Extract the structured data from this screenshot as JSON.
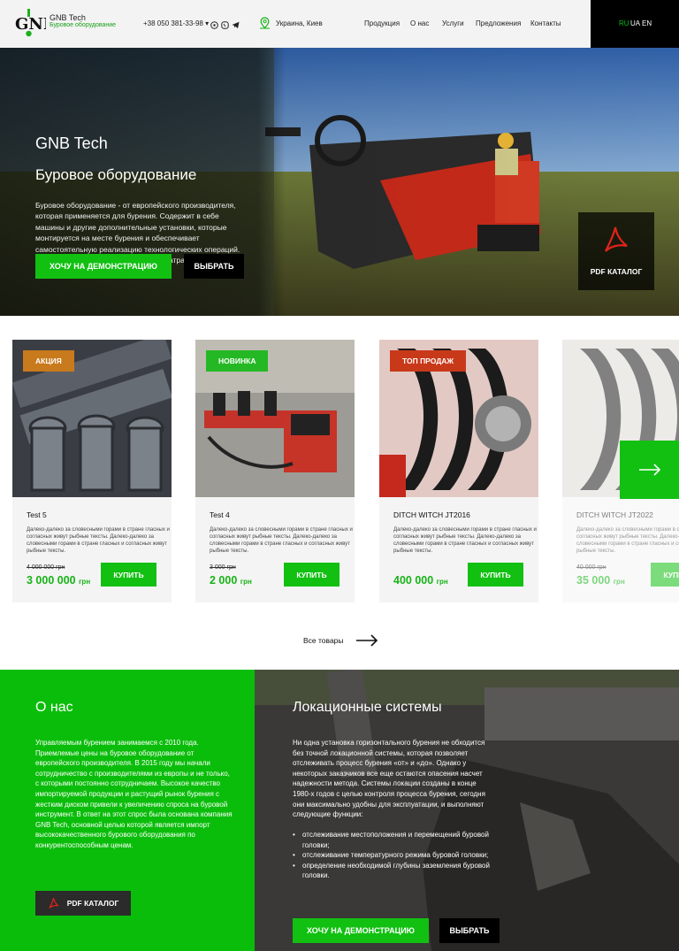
{
  "header": {
    "brand_name": "GNB Tech",
    "brand_sub": "Буровое оборудование",
    "phone": "+38 050 381-33-98",
    "location": "Украина, Киев",
    "nav": [
      "Продукция",
      "О нас",
      "Услуги",
      "Предложения",
      "Контакты"
    ],
    "langs": [
      "RU",
      "UA",
      "EN"
    ],
    "active_lang": "RU"
  },
  "hero": {
    "title": "GNB Tech",
    "subtitle": "Буровое оборудование",
    "text": "Буровое оборудование - от европейского производителя, которая применяется для бурения. Содержит в себе машины и другие дополнительные установки, которые монтируется на месте бурения и обеспечивает самостоятельную реализацию технологических операций. Окупается оно быстро, а небольшие затраты делают бизнес перспективным",
    "demo_button": "ХОЧУ НА ДЕМОНСТРАЦИЮ",
    "choose_button": "ВЫБРАТЬ",
    "pdf_label": "PDF КАТАЛОГ"
  },
  "products": [
    {
      "badge": "АКЦИЯ",
      "title": "Test 5",
      "desc": "Далеко-далеко за словесными горами в стране гласных и согласных живут рыбные тексты. Далеко-далеко за словесными горами в стране гласных и согласных живут рыбные тексты.",
      "old_price": "4 000 000 грн",
      "price": "3 000 000",
      "currency": "грн",
      "buy": "КУПИТЬ"
    },
    {
      "badge": "НОВИНКА",
      "title": "Test 4",
      "desc": "Далеко-далеко за словесными горами в стране гласных и согласных живут рыбные тексты. Далеко-далеко за словесными горами в стране гласных и согласных живут рыбные тексты.",
      "old_price": "3 000 грн",
      "price": "2 000",
      "currency": "грн",
      "buy": "КУПИТЬ"
    },
    {
      "badge": "ТОП ПРОДАЖ",
      "title": "DITCH WITCH JT2016",
      "desc": "Далеко-далеко за словесными горами в стране гласных и согласных живут рыбные тексты. Далеко-далеко за словесными горами в стране гласных и согласных живут рыбные тексты.",
      "old_price": "",
      "price": "400 000",
      "currency": "грн",
      "buy": "КУПИТЬ"
    },
    {
      "badge": "",
      "title": "DITCH WITCH JT2022",
      "desc": "Далеко-далеко за словесными горами в стране гласных и согласных живут рыбные тексты. Далеко-далеко за словесными горами в стране гласных и согласных живут рыбные тексты.",
      "old_price": "40 000 грн",
      "price": "35 000",
      "currency": "грн",
      "buy": "КУПИТЬ"
    }
  ],
  "all_goods": "Все товары",
  "about": {
    "title": "О нас",
    "text": "Управляемым бурением занимаемся с 2010 года. Приемлемые цены на буровое оборудование от европейского производителя. В 2015 году мы начали сотрудничество с производителями из европы и не только, с которыми постоянно сотрудничаем. Высокое качество импортируемой продукции и растущий рынок бурения с жестким диском привели к увеличению спроса на буровой инструмент. В ответ на этот спрос была основана компания GNB Tech, основной целью которой является импорт высококачественного бурового оборудования по конкурентоспособным ценам.",
    "pdf_button": "PDF КАТАЛОГ"
  },
  "locsys": {
    "title": "Локационные системы",
    "text": "Ни одна установка горизонтального бурения не обходится без точной локационной системы, которая позволяет отслеживать процесс бурения «от» и «до». Однако у некоторых заказчиков все еще остаются опасения насчет надежности метода. Системы локации созданы в конце 1980-х годов с целью контроля процесса бурения, сегодня они максимально удобны для эксплуатации, и выполняют следующие функции:",
    "list": [
      "отслеживание местоположения и перемещений буровой головки;",
      "отслеживание температурного режима буровой головки;",
      "определение необходимой глубины заземления буровой головки."
    ],
    "demo_button": "ХОЧУ НА ДЕМОНСТРАЦИЮ",
    "choose_button": "ВЫБРАТЬ"
  },
  "colors": {
    "accent": "#12c012",
    "dark": "#000000",
    "badge_sale": "#c87a1c",
    "badge_new": "#25b825",
    "badge_top": "#c8391a"
  }
}
